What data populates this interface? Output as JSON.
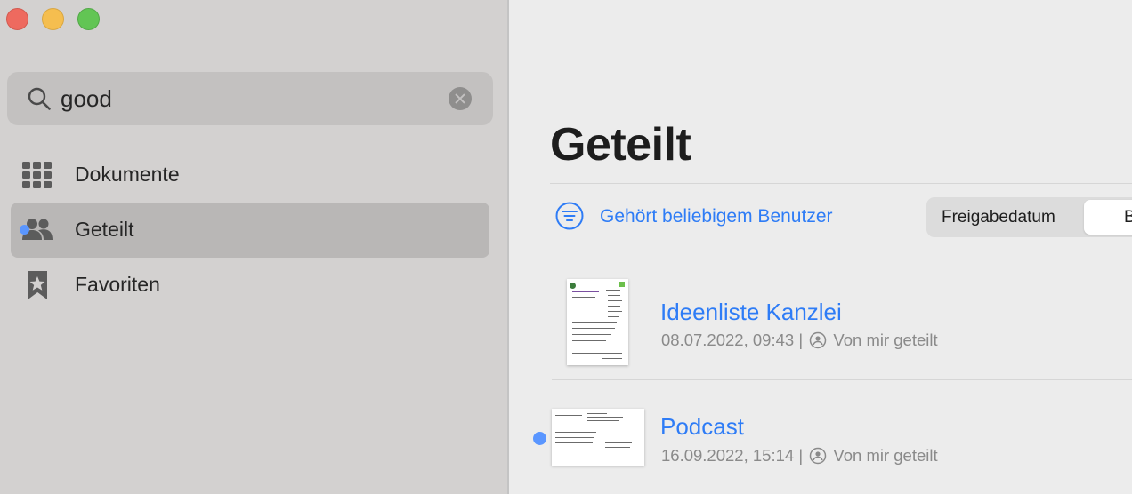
{
  "window": {
    "controls": [
      "close",
      "minimize",
      "zoom"
    ]
  },
  "sidebar": {
    "search": {
      "value": "good",
      "icon": "search-icon",
      "clear_icon": "clear-icon"
    },
    "items": [
      {
        "label": "Dokumente",
        "icon": "grid-icon",
        "selected": false
      },
      {
        "label": "Geteilt",
        "icon": "people-icon",
        "selected": true
      },
      {
        "label": "Favoriten",
        "icon": "bookmark-star-icon",
        "selected": false
      }
    ]
  },
  "main": {
    "title": "Geteilt",
    "filter": {
      "label": "Gehört beliebigem Benutzer",
      "icon": "filter-icon"
    },
    "sort": {
      "options": [
        "Freigabedatum",
        "B"
      ],
      "selected_index": 1
    },
    "documents": [
      {
        "title": "Ideenliste Kanzlei",
        "date": "08.07.2022, 09:43",
        "separator": "|",
        "status": "Von mir geteilt",
        "unread": false
      },
      {
        "title": "Podcast",
        "date": "16.09.2022, 15:14",
        "separator": "|",
        "status": "Von mir geteilt",
        "unread": true
      }
    ]
  },
  "colors": {
    "accent": "#2e7cf6",
    "sidebar_bg": "#d3d1d0",
    "main_bg": "#ececec",
    "unread_dot": "#5a96ff"
  }
}
